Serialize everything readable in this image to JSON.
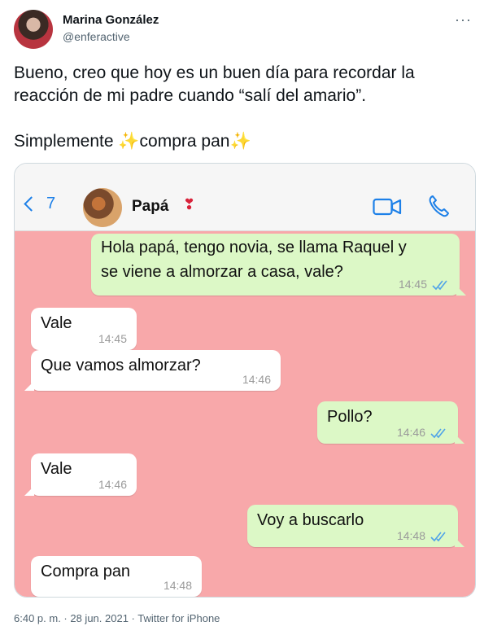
{
  "tweet": {
    "author_name": "Marina González",
    "author_handle": "@enferactive",
    "more_label": "···",
    "text_line1": "Bueno, creo que hoy es un buen día para recordar la",
    "text_line2": "reacción de mi padre cuando “salí del amario”.",
    "text_line3_a": "Simplemente ",
    "sparkle_left": "✨",
    "text_line3_b": "compra pan",
    "sparkle_right": "✨",
    "meta": "6:40 p. m. · 28 jun. 2021 · Twitter for iPhone"
  },
  "chat": {
    "back_count": "7",
    "contact_name": "Papá",
    "contact_emoji": "❣",
    "icons": {
      "video": "video-camera-icon",
      "call": "phone-icon",
      "back": "chevron-left-icon"
    },
    "colors": {
      "background": "#f8a8aa",
      "incoming": "#ffffff",
      "outgoing": "#dcf8c6",
      "accent": "#1d80e8"
    },
    "messages": [
      {
        "dir": "out",
        "line1": "Hola papá, tengo novia, se llama Raquel y",
        "line2": "se viene a almorzar a casa, vale?",
        "time": "14:45",
        "read": true
      },
      {
        "dir": "in",
        "text": "Vale",
        "time": "14:45"
      },
      {
        "dir": "in",
        "text": "Que vamos almorzar?",
        "time": "14:46"
      },
      {
        "dir": "out",
        "text": "Pollo?",
        "time": "14:46",
        "read": true
      },
      {
        "dir": "in",
        "text": "Vale",
        "time": "14:46"
      },
      {
        "dir": "out",
        "text": "Voy a buscarlo",
        "time": "14:48",
        "read": true
      },
      {
        "dir": "in",
        "text": "Compra pan",
        "time": "14:48"
      }
    ]
  }
}
